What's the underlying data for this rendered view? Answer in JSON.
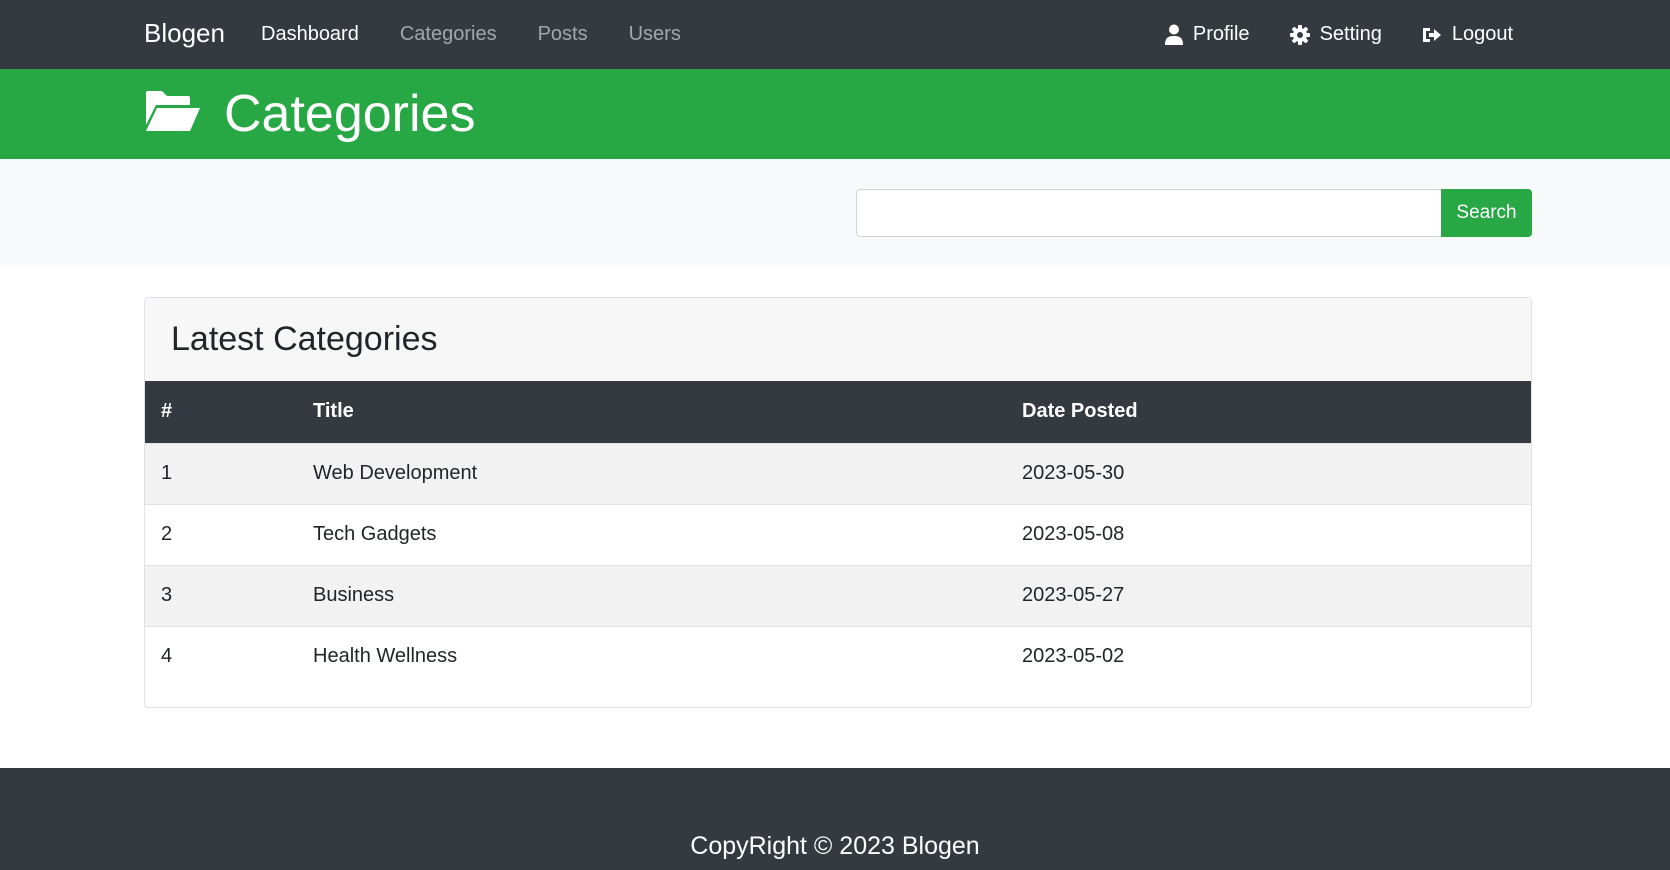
{
  "navbar": {
    "brand": "Blogen",
    "links": [
      {
        "label": "Dashboard",
        "active": true
      },
      {
        "label": "Categories",
        "active": false
      },
      {
        "label": "Posts",
        "active": false
      },
      {
        "label": "Users",
        "active": false
      }
    ],
    "right_links": [
      {
        "label": "Profile",
        "icon": "user-icon"
      },
      {
        "label": "Setting",
        "icon": "gear-icon"
      },
      {
        "label": "Logout",
        "icon": "sign-out-icon"
      }
    ]
  },
  "header": {
    "title": "Categories",
    "icon": "folder-open-icon"
  },
  "search": {
    "value": "",
    "button_label": "Search"
  },
  "card": {
    "title": "Latest Categories",
    "columns": [
      "#",
      "Title",
      "Date Posted"
    ],
    "rows": [
      {
        "num": "1",
        "title": "Web Development",
        "date": "2023-05-30"
      },
      {
        "num": "2",
        "title": "Tech Gadgets",
        "date": "2023-05-08"
      },
      {
        "num": "3",
        "title": "Business",
        "date": "2023-05-27"
      },
      {
        "num": "4",
        "title": "Health Wellness",
        "date": "2023-05-02"
      }
    ]
  },
  "footer": {
    "text": "CopyRight © 2023 Blogen"
  },
  "colors": {
    "navbar": "#343a40",
    "accent": "#28a745",
    "band": "#f8f9fa"
  }
}
